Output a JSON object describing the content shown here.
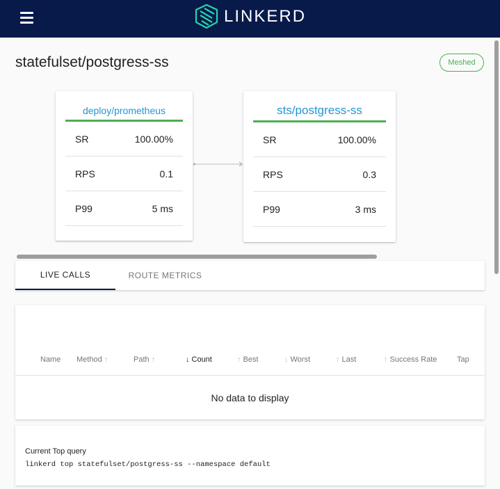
{
  "app": {
    "logo_text": "LINKERD"
  },
  "page": {
    "title": "statefulset/postgress-ss",
    "badge": "Meshed"
  },
  "topology": {
    "source": {
      "name": "deploy/prometheus",
      "metrics": [
        {
          "label": "SR",
          "value": "100.00%"
        },
        {
          "label": "RPS",
          "value": "0.1"
        },
        {
          "label": "P99",
          "value": "5 ms"
        }
      ]
    },
    "target": {
      "name": "sts/postgress-ss",
      "metrics": [
        {
          "label": "SR",
          "value": "100.00%"
        },
        {
          "label": "RPS",
          "value": "0.3"
        },
        {
          "label": "P99",
          "value": "3 ms"
        }
      ]
    }
  },
  "tabs": [
    {
      "label": "LIVE CALLS",
      "active": true
    },
    {
      "label": "ROUTE METRICS",
      "active": false
    }
  ],
  "table": {
    "columns": [
      "Name",
      "Method",
      "Path",
      "Count",
      "Best",
      "Worst",
      "Last",
      "Success Rate",
      "Tap"
    ],
    "empty_message": "No data to display"
  },
  "query": {
    "label": "Current Top query",
    "command": "linkerd top statefulset/postgress-ss --namespace default"
  },
  "colors": {
    "appbar": "#071a4a",
    "accent": "#4caf50",
    "link": "#2196d3"
  }
}
